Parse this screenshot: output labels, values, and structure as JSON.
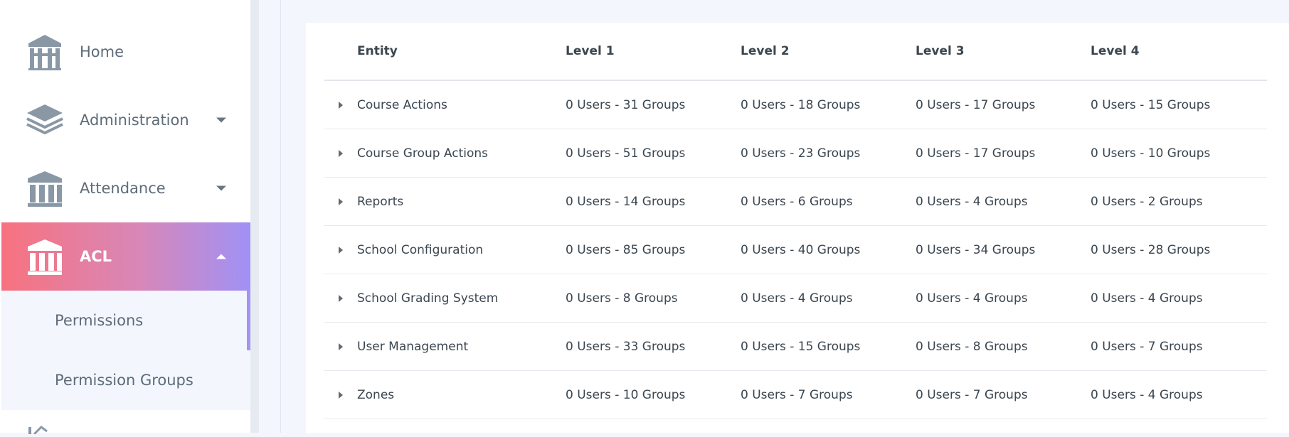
{
  "sidebar": {
    "items": [
      {
        "label": "Home",
        "icon": "building-icon"
      },
      {
        "label": "Administration",
        "icon": "layers-icon"
      },
      {
        "label": "Attendance",
        "icon": "institution-icon"
      },
      {
        "label": "ACL",
        "icon": "institution-icon"
      }
    ],
    "submenu": [
      {
        "label": "Permissions"
      },
      {
        "label": "Permission Groups"
      }
    ]
  },
  "table": {
    "headers": [
      "Entity",
      "Level 1",
      "Level 2",
      "Level 3",
      "Level 4"
    ],
    "rows": [
      {
        "entity": "Course Actions",
        "l1": "0 Users - 31 Groups",
        "l2": "0 Users - 18 Groups",
        "l3": "0 Users - 17 Groups",
        "l4": "0 Users - 15 Groups"
      },
      {
        "entity": "Course Group Actions",
        "l1": "0 Users - 51 Groups",
        "l2": "0 Users - 23 Groups",
        "l3": "0 Users - 17 Groups",
        "l4": "0 Users - 10 Groups"
      },
      {
        "entity": "Reports",
        "l1": "0 Users - 14 Groups",
        "l2": "0 Users - 6 Groups",
        "l3": "0 Users - 4 Groups",
        "l4": "0 Users - 2 Groups"
      },
      {
        "entity": "School Configuration",
        "l1": "0 Users - 85 Groups",
        "l2": "0 Users - 40 Groups",
        "l3": "0 Users - 34 Groups",
        "l4": "0 Users - 28 Groups"
      },
      {
        "entity": "School Grading System",
        "l1": "0 Users - 8 Groups",
        "l2": "0 Users - 4 Groups",
        "l3": "0 Users - 4 Groups",
        "l4": "0 Users - 4 Groups"
      },
      {
        "entity": "User Management",
        "l1": "0 Users - 33 Groups",
        "l2": "0 Users - 15 Groups",
        "l3": "0 Users - 8 Groups",
        "l4": "0 Users - 7 Groups"
      },
      {
        "entity": "Zones",
        "l1": "0 Users - 10 Groups",
        "l2": "0 Users - 7 Groups",
        "l3": "0 Users - 7 Groups",
        "l4": "0 Users - 4 Groups"
      }
    ]
  },
  "colors": {
    "active_gradient_start": "#f7727f",
    "active_gradient_end": "#a091f6",
    "icon_gray": "#8a98a6"
  }
}
